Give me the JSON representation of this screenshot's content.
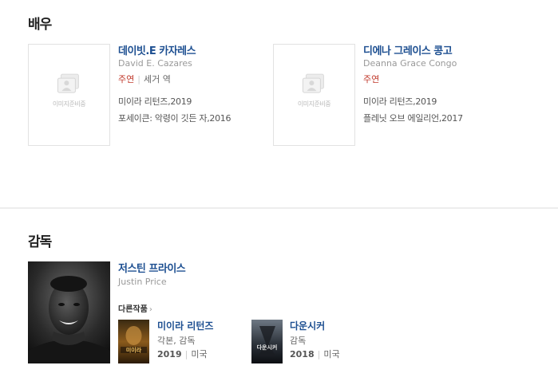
{
  "actors_section": {
    "title": "배우",
    "actors": [
      {
        "placeholder_text": "이미지준비중",
        "name_ko": "데이빗.E 카자레스",
        "name_en": "David E. Cazares",
        "role": "주연",
        "character": "세거 역",
        "films": [
          "미이라 리턴즈,2019",
          "포세이큰: 악령이 깃든 자,2016"
        ]
      },
      {
        "placeholder_text": "이미지준비중",
        "name_ko": "디에나 그레이스 콩고",
        "name_en": "Deanna Grace Congo",
        "role": "주연",
        "character": "",
        "films": [
          "미이라 리턴즈,2019",
          "플레닛 오브 에일리언,2017"
        ]
      }
    ]
  },
  "director_section": {
    "title": "감독",
    "director": {
      "name_ko": "저스틴 프라이스",
      "name_en": "Justin Price",
      "other_works_label": "다른작품",
      "works": [
        {
          "title": "미이라 리턴즈",
          "poster_text": "미이라",
          "role": "각본, 감독",
          "year": "2019",
          "country": "미국"
        },
        {
          "title": "다운시커",
          "poster_text": "다운시커",
          "role": "감독",
          "year": "2018",
          "country": "미국"
        }
      ]
    }
  },
  "colors": {
    "name_link": "#1d4f91",
    "role_red": "#c0392b",
    "divider": "#ededed"
  }
}
